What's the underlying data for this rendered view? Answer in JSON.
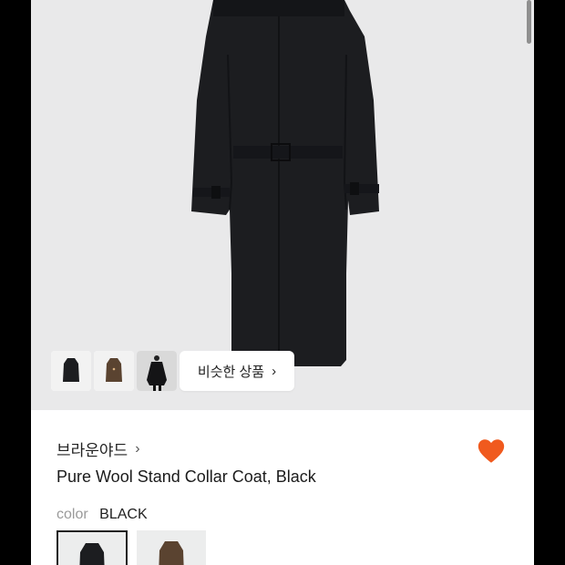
{
  "product": {
    "brand": "브라운야드",
    "brand_chevron": "›",
    "title": "Pure Wool Stand Collar Coat, Black",
    "color_label": "color",
    "color_value": "BLACK"
  },
  "hero": {
    "similar_label": "비슷한 상품",
    "similar_chevron": "›",
    "thumbnails": [
      "black-coat-thumbnail",
      "brown-coat-thumbnail",
      "model-coat-thumbnail"
    ]
  },
  "colors": {
    "heart": "#f05a1e",
    "background": "#e9e9ea",
    "coat": "#1c1d20",
    "brown_coat": "#5a4330"
  },
  "swatches": [
    {
      "name": "BLACK",
      "selected": true
    },
    {
      "name": "BROWN",
      "selected": false
    }
  ]
}
